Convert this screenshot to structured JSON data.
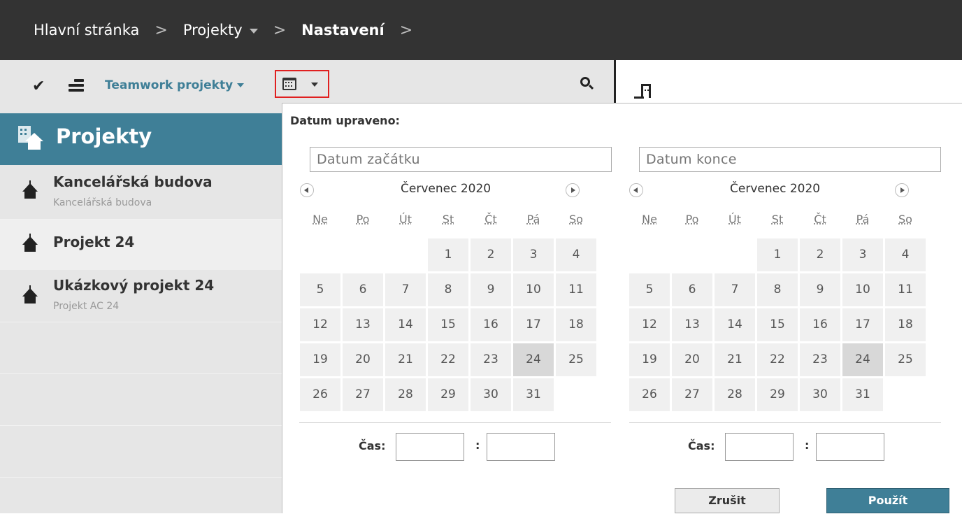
{
  "breadcrumb": {
    "items": [
      "Hlavní stránka",
      "Projekty",
      "Nastavení"
    ],
    "separator": ">"
  },
  "toolbar": {
    "check_icon": "check-icon",
    "list_icon": "list-icon",
    "filter_label": "Teamwork projekty",
    "calendar_icon": "calendar-icon",
    "search_icon": "search-icon"
  },
  "sidebar": {
    "header": "Projekty",
    "projects": [
      {
        "title": "Kancelářská budova",
        "subtitle": "Kancelářská budova"
      },
      {
        "title": "Projekt 24",
        "subtitle": ""
      },
      {
        "title": "Ukázkový projekt 24",
        "subtitle": "Projekt AC 24"
      }
    ]
  },
  "date_filter": {
    "label": "Datum upraveno:",
    "start": {
      "placeholder": "Datum začátku",
      "month": "Červenec 2020",
      "time_label": "Čas:"
    },
    "end": {
      "placeholder": "Datum konce",
      "month": "Červenec 2020",
      "time_label": "Čas:"
    },
    "weekdays": [
      "Ne",
      "Po",
      "Út",
      "St",
      "Čt",
      "Pá",
      "So"
    ],
    "first_weekday_index": 3,
    "days_in_month": 31,
    "highlighted_day": 24,
    "time_separator": ":",
    "cancel_label": "Zrušit",
    "apply_label": "Použít"
  },
  "colors": {
    "accent": "#3f7f97",
    "topbar": "#333333",
    "highlight_border": "#e02020"
  }
}
